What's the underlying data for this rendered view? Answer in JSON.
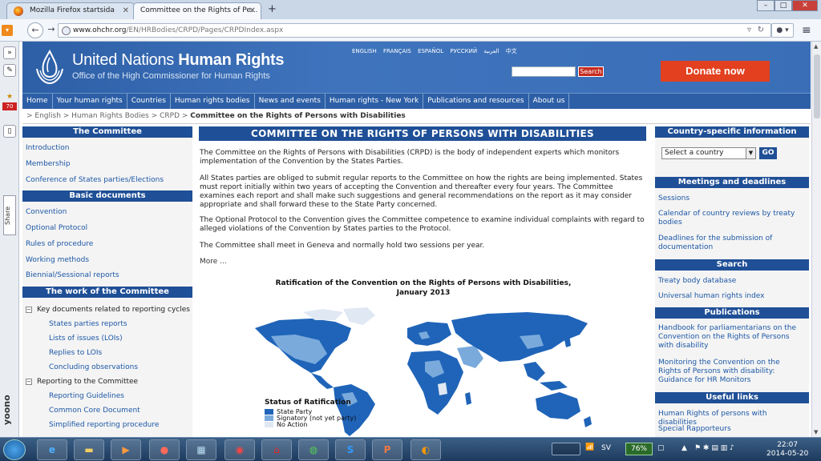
{
  "browser": {
    "tabs": [
      {
        "title": "Mozilla Firefox startsida"
      },
      {
        "title": "Committee on the Rights of Pe..."
      }
    ],
    "new_tab_symbol": "+",
    "url_domain": "www.ohchr.org",
    "url_path": "/EN/HRBodies/CRPD/Pages/CRPDIndex.aspx",
    "window_buttons": [
      "–",
      "□",
      "✕"
    ],
    "sidebar": {
      "badge": "70",
      "share_label": "Share",
      "yoono_label": "yoono"
    }
  },
  "site": {
    "title_prefix": "United Nations",
    "title_bold": "Human Rights",
    "subtitle": "Office of the High Commissioner for Human Rights",
    "languages": [
      "ENGLISH",
      "FRANÇAIS",
      "ESPAÑOL",
      "РУССКИЙ",
      "العربية",
      "中文"
    ],
    "search_button": "Search",
    "donate_label": "Donate now",
    "nav": [
      "Home",
      "Your human rights",
      "Countries",
      "Human rights bodies",
      "News and events",
      "Human rights - New York",
      "Publications and resources",
      "About us"
    ],
    "breadcrumb": {
      "parts": "> English > Human Rights Bodies > CRPD >",
      "current": "Committee on the Rights of Persons with Disabilities"
    },
    "accent_color": "#1f4f96",
    "donate_color": "#e2401f"
  },
  "left": {
    "committee_heading": "The Committee",
    "committee_links": [
      "Introduction",
      "Membership",
      "Conference of States parties/Elections"
    ],
    "basic_heading": "Basic documents",
    "basic_links": [
      "Convention",
      "Optional Protocol",
      "Rules of procedure",
      "Working methods",
      "Biennial/Sessional reports"
    ],
    "work_heading": "The work of the Committee",
    "tree1_label": "Key documents related to reporting cycles",
    "tree1_children": [
      "States parties reports",
      "Lists of issues (LOIs)",
      "Replies to LOIs",
      "Concluding observations"
    ],
    "tree2_label": "Reporting to the Committee",
    "tree2_children": [
      "Reporting Guidelines",
      "Common Core Document",
      "Simplified reporting procedure"
    ],
    "tree_toggle": "−"
  },
  "main": {
    "title": "COMMITTEE ON THE RIGHTS OF PERSONS WITH DISABILITIES",
    "paragraphs": [
      "The Committee on the Rights of Persons with Disabilities (CRPD) is the body of independent experts which monitors implementation of the Convention by the States Parties.",
      "All States parties are obliged to submit regular reports to the Committee on how the rights are being implemented. States must report initially within two years of accepting the Convention and thereafter every four years. The Committee examines each report and shall make such suggestions and general recommendations on the report as it may consider appropriate and shall forward these to the State Party concerned.",
      "The Optional Protocol to the Convention gives the Committee competence to examine individual complaints with regard to alleged violations of the Convention by States parties to the Protocol.",
      "The Committee shall meet in Geneva and normally hold two sessions per year."
    ],
    "more": "More ...",
    "map": {
      "title_line1": "Ratification of the Convention on the Rights of Persons with Disabilities,",
      "title_line2": "January 2013",
      "legend_title": "Status of Ratification",
      "legend": [
        {
          "label": "State Party",
          "color": "#1f64b8"
        },
        {
          "label": "Signatory (not yet party)",
          "color": "#7aaadc"
        },
        {
          "label": "No Action",
          "color": "#dfe8f3"
        }
      ]
    }
  },
  "right": {
    "country_heading": "Country-specific information",
    "country_select": "Select a country",
    "go_label": "GO",
    "meetings_heading": "Meetings and deadlines",
    "meetings_links": [
      "Sessions",
      "Calendar of country reviews by treaty bodies",
      "Deadlines for the submission of documentation"
    ],
    "search_heading": "Search",
    "search_links": [
      "Treaty body database",
      "Universal human rights index"
    ],
    "pubs_heading": "Publications",
    "pubs_links": [
      "Handbook for parliamentarians on the Convention on the Rights of Persons with disability",
      "Monitoring the Convention on the Rights of Persons with disability: Guidance for HR Monitors"
    ],
    "useful_heading": "Useful links",
    "useful_links": [
      "Human Rights of persons with disabilities",
      "Special Rapporteurs"
    ]
  },
  "taskbar": {
    "apps": [
      "e-icon",
      "folder-icon",
      "media-icon",
      "gadget-icon",
      "remote-icon",
      "hotspot-icon",
      "pdf-icon",
      "spotify-icon",
      "skype-icon",
      "powerpoint-icon",
      "firefox-icon"
    ],
    "language": "SV",
    "battery": "76%",
    "time": "22:07",
    "date": "2014-05-20"
  }
}
